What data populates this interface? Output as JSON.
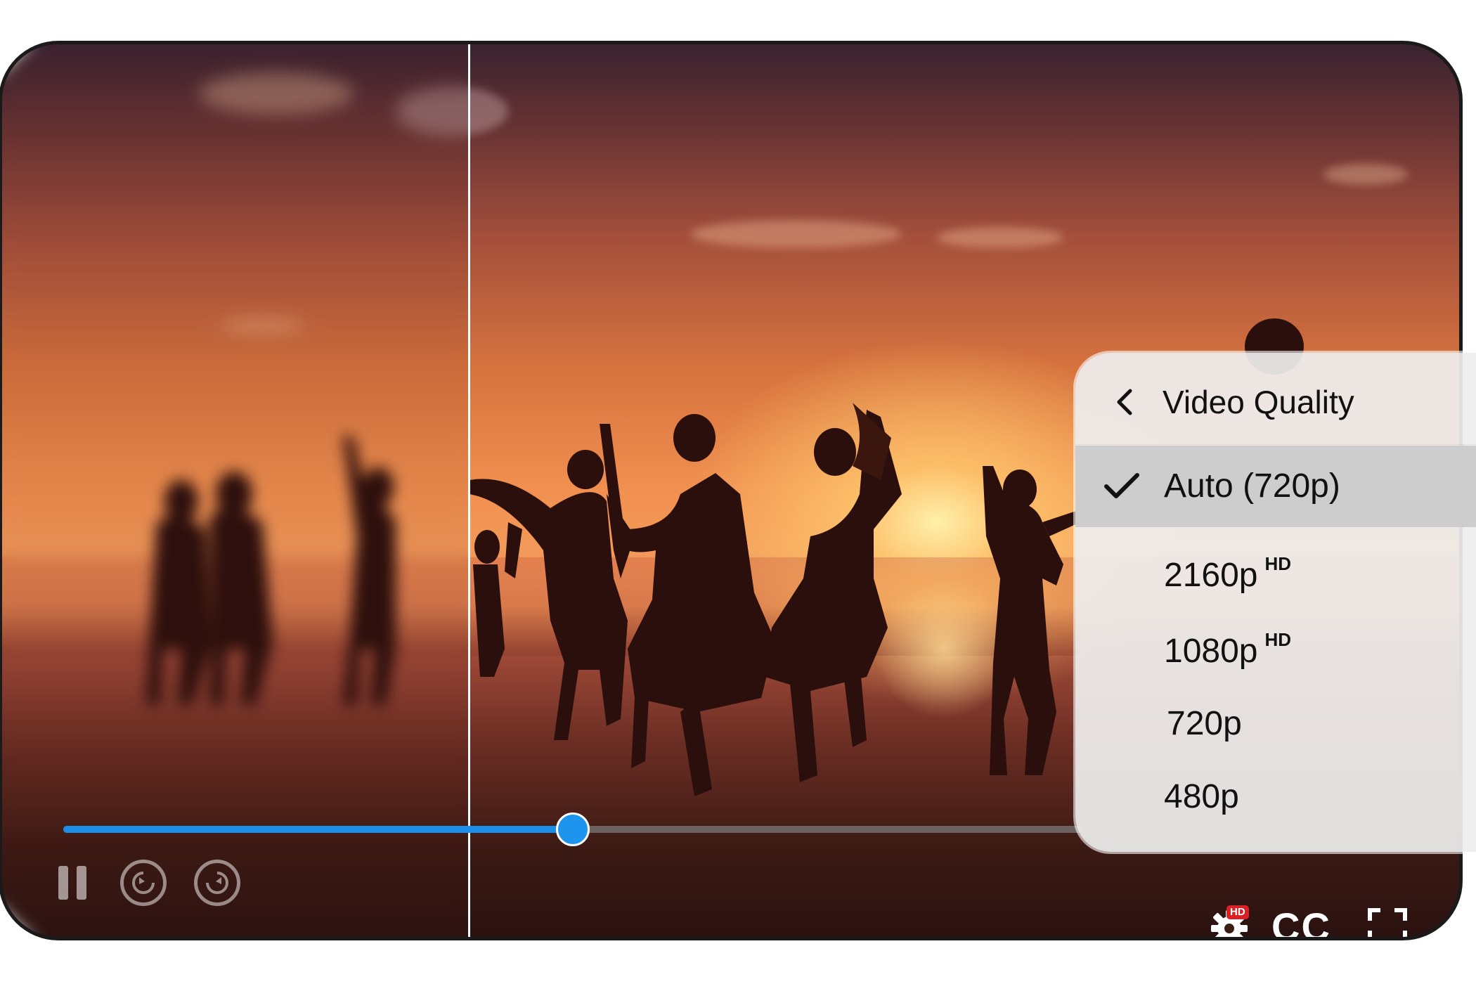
{
  "player": {
    "progress_fraction": 0.5,
    "split_fraction": 0.32
  },
  "controls": {
    "pause_icon": "pause-icon",
    "rewind_icon": "replay-10-icon",
    "forward_icon": "forward-10-icon",
    "settings_icon": "gear-icon",
    "settings_badge": "HD",
    "captions_label": "CC",
    "fullscreen_icon": "fullscreen-icon"
  },
  "quality_menu": {
    "title": "Video Quality",
    "back_icon": "chevron-left-icon",
    "items": [
      {
        "label": "Auto (720p)",
        "sup": "",
        "selected": true
      },
      {
        "label": "2160p",
        "sup": "HD",
        "selected": false
      },
      {
        "label": "1080p",
        "sup": "HD",
        "selected": false
      },
      {
        "label": "720p",
        "sup": "",
        "selected": false
      },
      {
        "label": "480p",
        "sup": "",
        "selected": false
      }
    ]
  },
  "colors": {
    "accent": "#1a8ee8",
    "badge": "#d92025",
    "menu_selected": "#cdcdcd"
  }
}
